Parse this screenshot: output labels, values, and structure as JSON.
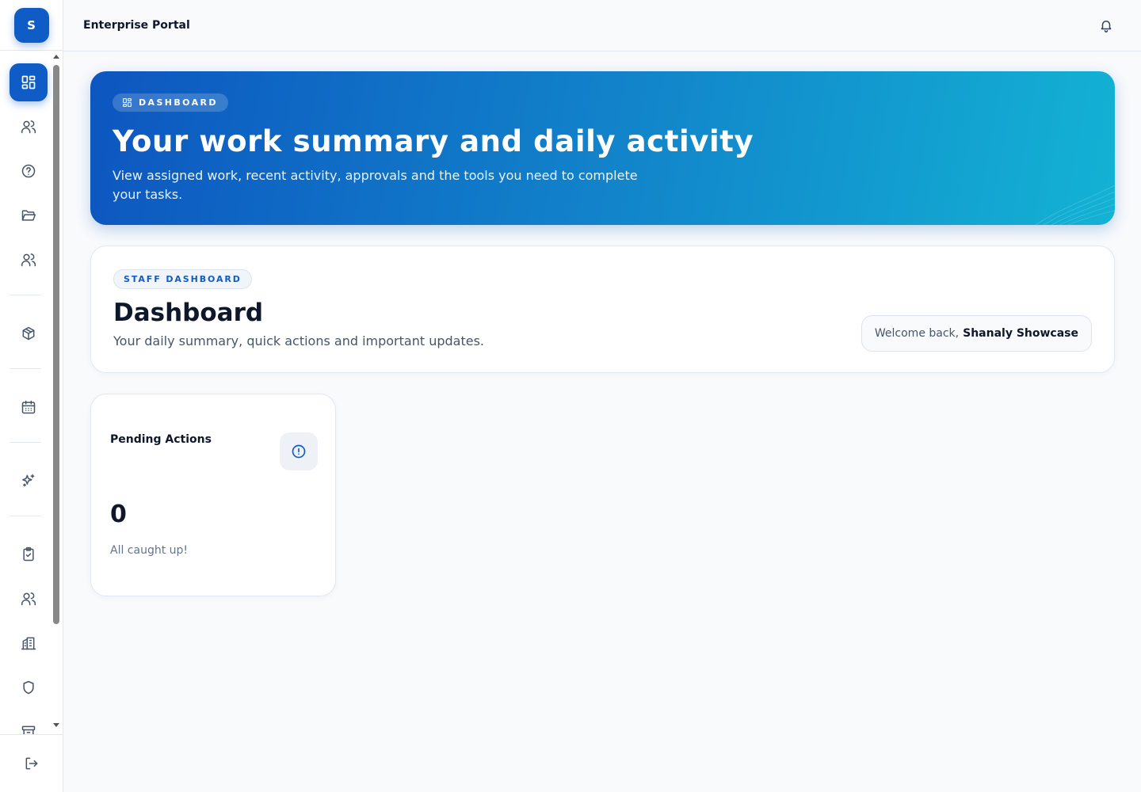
{
  "sidebar": {
    "avatar_initial": "S",
    "nav_icons": [
      "dashboard-icon",
      "users-icon",
      "help-icon",
      "folder-icon",
      "team-icon",
      "package-icon",
      "calendar-icon",
      "sparkles-icon",
      "clipboard-check-icon",
      "people-icon",
      "building-icon",
      "shield-icon",
      "archive-icon"
    ],
    "logout_icon": "logout-icon"
  },
  "header": {
    "title": "Enterprise Portal",
    "notification_icon": "bell-icon"
  },
  "hero": {
    "pill_label": "DASHBOARD",
    "title": "Your work summary and daily activity",
    "subtitle": "View assigned work, recent activity, approvals and the tools you need to complete your tasks."
  },
  "dashboard": {
    "pill_label": "STAFF DASHBOARD",
    "title": "Dashboard",
    "subtitle": "Your daily summary, quick actions and important updates.",
    "welcome_prefix": "Welcome back,",
    "user_name": "Shanaly Showcase"
  },
  "pending": {
    "title": "Pending Actions",
    "value": "0",
    "note": "All caught up!"
  },
  "colors": {
    "primary": "#0f5cc7",
    "hero_gradient_start": "#0d56c0",
    "hero_gradient_end": "#13b2d4",
    "background": "#f8fafc"
  }
}
